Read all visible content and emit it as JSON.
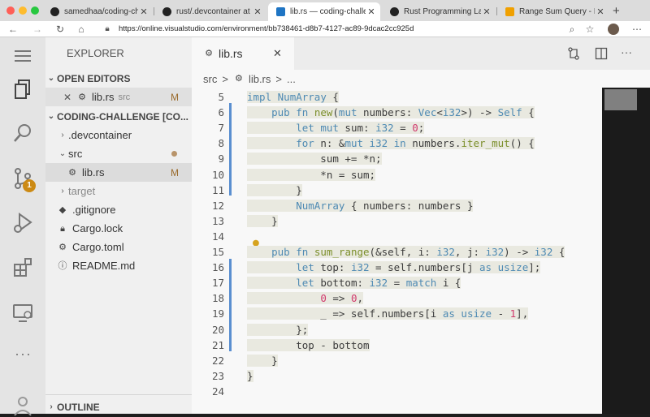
{
  "browser": {
    "tabs": [
      {
        "title": "samedhaa/coding-challeng",
        "favicon": "github-icon"
      },
      {
        "title": "rust/.devcontainer at master",
        "favicon": "github-icon"
      },
      {
        "title": "lib.rs — coding-challenge [C",
        "favicon": "vscode-icon"
      },
      {
        "title": "Rust Programming Language",
        "favicon": "rust-icon"
      },
      {
        "title": "Range Sum Query - Immutal",
        "favicon": "leetcode-icon"
      }
    ],
    "url": "https://online.visualstudio.com/environment/bb738461-d8b7-4127-ac89-9dcac2cc925d"
  },
  "activity": {
    "scm_badge": "1"
  },
  "sidebar": {
    "title": "EXPLORER",
    "open_editors_header": "OPEN EDITORS",
    "open_editor": {
      "name": "lib.rs",
      "folder": "src",
      "status": "M"
    },
    "workspace_header": "CODING-CHALLENGE [CO...",
    "tree": [
      {
        "name": ".devcontainer",
        "type": "folder"
      },
      {
        "name": "src",
        "type": "folder-open"
      },
      {
        "name": "lib.rs",
        "type": "file",
        "status": "M"
      },
      {
        "name": "target",
        "type": "folder"
      },
      {
        "name": ".gitignore",
        "type": "file"
      },
      {
        "name": "Cargo.lock",
        "type": "file"
      },
      {
        "name": "Cargo.toml",
        "type": "file"
      },
      {
        "name": "README.md",
        "type": "file"
      }
    ],
    "outline_header": "OUTLINE"
  },
  "editor": {
    "tab_label": "lib.rs",
    "breadcrumb": {
      "folder": "src",
      "sep": ">",
      "file": "lib.rs",
      "more": "..."
    },
    "line_numbers": [
      "5",
      "6",
      "7",
      "8",
      "9",
      "10",
      "11",
      "12",
      "13",
      "14",
      "15",
      "16",
      "17",
      "18",
      "19",
      "20",
      "21",
      "22",
      "23",
      "24"
    ],
    "lines": [
      "impl NumArray {",
      "    pub fn new(mut numbers: Vec<i32>) -> Self {",
      "        let mut sum: i32 = 0;",
      "        for n: &mut i32 in numbers.iter_mut() {",
      "            sum += *n;",
      "            *n = sum;",
      "        }",
      "        NumArray { numbers: numbers }",
      "    }",
      "",
      "    pub fn sum_range(&self, i: i32, j: i32) -> i32 {",
      "        let top: i32 = self.numbers[j as usize];",
      "        let bottom: i32 = match i {",
      "            0 => 0,",
      "            _ => self.numbers[i as usize - 1],",
      "        };",
      "        top - bottom",
      "    }",
      "}",
      ""
    ]
  }
}
